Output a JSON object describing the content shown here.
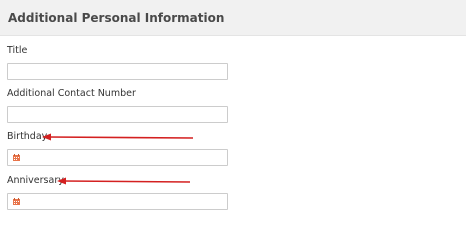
{
  "section": {
    "title": "Additional Personal Information"
  },
  "fields": {
    "title": {
      "label": "Title",
      "value": ""
    },
    "contact": {
      "label": "Additional Contact Number",
      "value": ""
    },
    "birthday": {
      "label": "Birthday",
      "value": "",
      "icon": "calendar-icon"
    },
    "anniversary": {
      "label": "Anniversary",
      "value": "",
      "icon": "calendar-icon"
    }
  },
  "colors": {
    "header_bg": "#f1f1f1",
    "calendar_icon": "#e8744a",
    "annotation_arrow": "#d42020"
  }
}
